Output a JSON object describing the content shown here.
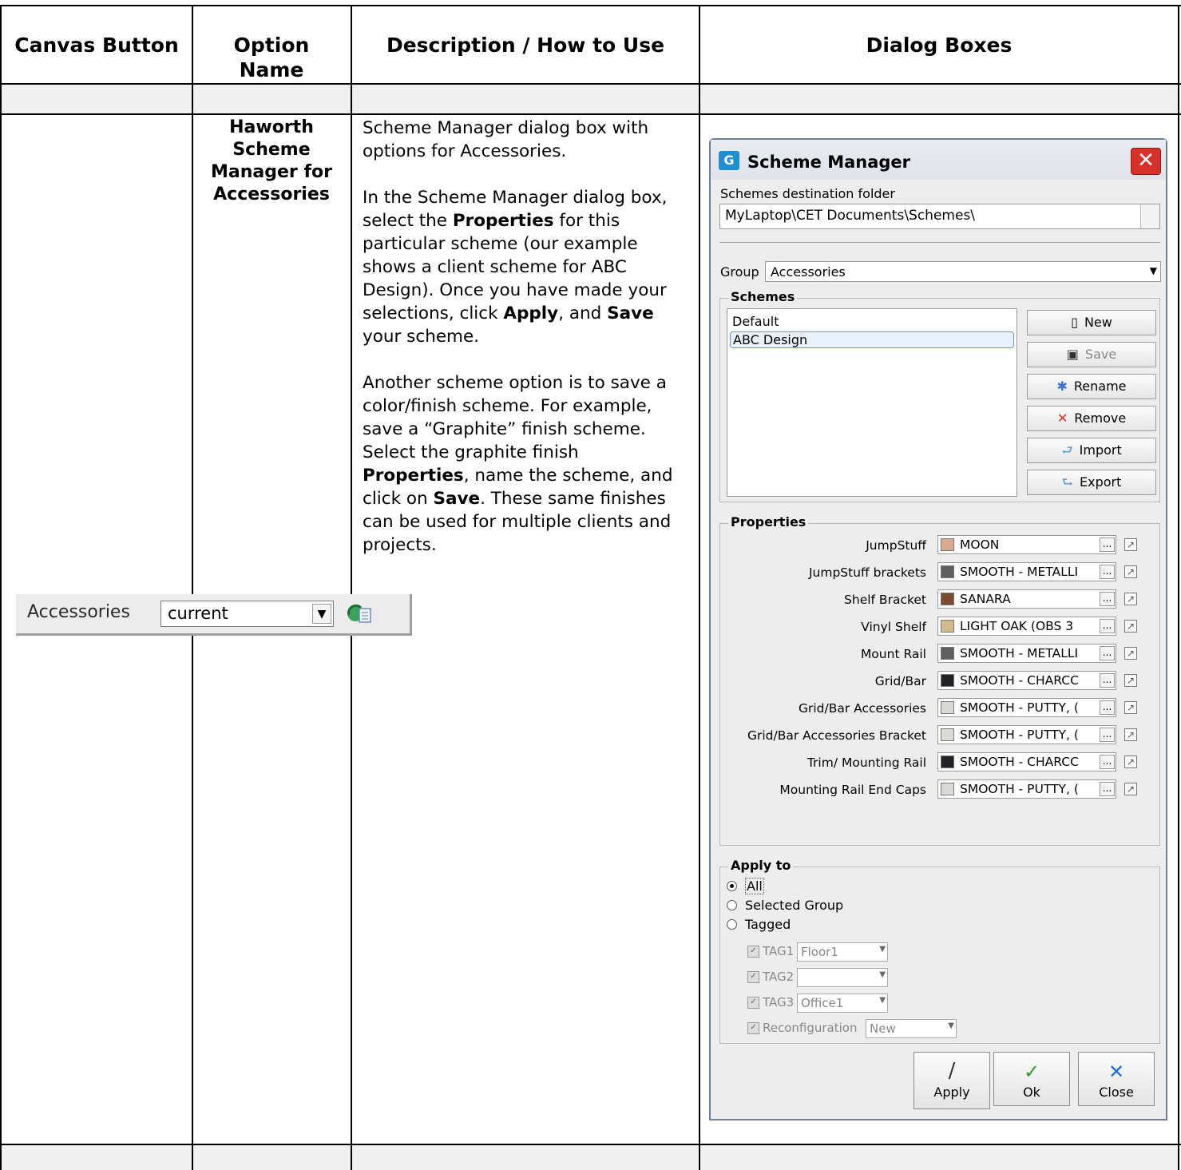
{
  "table": {
    "headers": {
      "canvas_button": "Canvas Button",
      "option_name": "Option Name",
      "description": "Description / How to Use",
      "dialog_boxes": "Dialog Boxes"
    },
    "row": {
      "option_name": "Haworth Scheme Manager for Accessories",
      "description_p1": "Scheme Manager dialog box with options for Accessories.",
      "description_p2_pre": "In the Scheme Manager dialog box, select the ",
      "description_p2_b1": "Properties",
      "description_p2_mid1": " for this particular scheme (our example shows a client scheme for ABC Design). Once you have made your selections, click ",
      "description_p2_b2": "Apply",
      "description_p2_mid2": ", and ",
      "description_p2_b3": "Save",
      "description_p2_post": " your scheme.",
      "description_p3_pre": "Another scheme option is to save a color/finish scheme. For example, save a “Graphite” finish scheme. Select the graphite finish ",
      "description_p3_b1": "Properties",
      "description_p3_mid": ", name the scheme, and click on ",
      "description_p3_b2": "Save",
      "description_p3_post": ". These same finishes can be used for multiple clients and projects."
    }
  },
  "canvas_button": {
    "label": "Accessories",
    "select_value": "current",
    "icon": "scheme-manager-icon"
  },
  "dialog": {
    "title": "Scheme Manager",
    "folder_label": "Schemes destination folder",
    "folder_value": "MyLaptop\\CET Documents\\Schemes\\",
    "group_label": "Group",
    "group_value": "Accessories",
    "schemes_title": "Schemes",
    "schemes": [
      "Default",
      "ABC Design"
    ],
    "selected_scheme": "ABC Design",
    "buttons": {
      "new": "New",
      "save": "Save",
      "rename": "Rename",
      "remove": "Remove",
      "import": "Import",
      "export": "Export"
    },
    "properties_title": "Properties",
    "properties": [
      {
        "label": "JumpStuff",
        "value": "MOON",
        "color": "#d9a98f"
      },
      {
        "label": "JumpStuff brackets",
        "value": "SMOOTH - METALLI",
        "color": "#5f5f5f"
      },
      {
        "label": "Shelf Bracket",
        "value": "SANARA",
        "color": "#7a4a33"
      },
      {
        "label": "Vinyl Shelf",
        "value": "LIGHT OAK (OBS 3",
        "color": "#d2b98c"
      },
      {
        "label": "Mount Rail",
        "value": "SMOOTH - METALLI",
        "color": "#5f5f5f"
      },
      {
        "label": "Grid/Bar",
        "value": "SMOOTH - CHARCC",
        "color": "#222226"
      },
      {
        "label": "Grid/Bar Accessories",
        "value": "SMOOTH - PUTTY, (",
        "color": "#d9d9d6"
      },
      {
        "label": "Grid/Bar Accessories Bracket",
        "value": "SMOOTH - PUTTY, (",
        "color": "#d9d9d6"
      },
      {
        "label": "Trim/ Mounting Rail",
        "value": "SMOOTH - CHARCC",
        "color": "#222226"
      },
      {
        "label": "Mounting Rail End Caps",
        "value": "SMOOTH - PUTTY, (",
        "color": "#d9d9d6"
      }
    ],
    "apply_to_title": "Apply to",
    "apply_to_options": [
      "All",
      "Selected Group",
      "Tagged"
    ],
    "apply_to_selected": "All",
    "tags": [
      {
        "label": "TAG1",
        "value": "Floor1"
      },
      {
        "label": "TAG2",
        "value": ""
      },
      {
        "label": "TAG3",
        "value": "Office1"
      },
      {
        "label": "Reconfiguration",
        "value": "New"
      }
    ],
    "footer_buttons": {
      "apply": "Apply",
      "ok": "Ok",
      "close": "Close"
    },
    "colors": {
      "close_button": "#d8312b",
      "ok_check": "#2a9a2a",
      "close_x": "#1e6fd0"
    }
  }
}
